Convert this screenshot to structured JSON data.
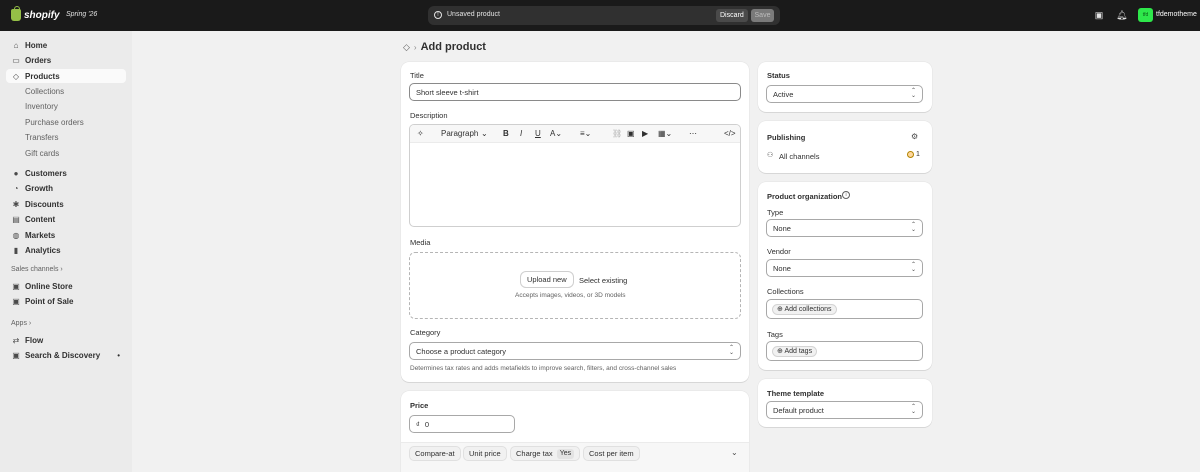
{
  "topbar": {
    "brand": "shopify",
    "edition": "Spring '26",
    "unsaved_label": "Unsaved product",
    "discard_label": "Discard",
    "save_label": "Save",
    "avatar_initials": "tfd",
    "store_name": "tfdemotheme"
  },
  "sidebar": {
    "main": [
      {
        "label": "Home",
        "icon": "home-icon"
      },
      {
        "label": "Orders",
        "icon": "inbox-icon"
      },
      {
        "label": "Products",
        "icon": "tag-icon"
      }
    ],
    "product_sub": [
      "Collections",
      "Inventory",
      "Purchase orders",
      "Transfers",
      "Gift cards"
    ],
    "more": [
      {
        "label": "Customers",
        "icon": "person-icon"
      },
      {
        "label": "Growth",
        "icon": "growth-icon"
      },
      {
        "label": "Discounts",
        "icon": "discount-icon"
      },
      {
        "label": "Content",
        "icon": "content-icon"
      },
      {
        "label": "Markets",
        "icon": "globe-icon"
      },
      {
        "label": "Analytics",
        "icon": "chart-icon"
      }
    ],
    "sales_channels_label": "Sales channels ›",
    "channels": [
      "Online Store",
      "Point of Sale"
    ],
    "apps_label": "Apps ›",
    "apps": [
      "Flow",
      "Search & Discovery"
    ]
  },
  "page": {
    "title": "Add product"
  },
  "product": {
    "title_label": "Title",
    "title_value": "Short sleeve t-shirt",
    "description_label": "Description",
    "paragraph_label": "Paragraph",
    "media_label": "Media",
    "upload_label": "Upload new",
    "select_existing_label": "Select existing",
    "media_hint": "Accepts images, videos, or 3D models",
    "category_label": "Category",
    "category_placeholder": "Choose a product category",
    "category_hint": "Determines tax rates and adds metafields to improve search, filters, and cross-channel sales"
  },
  "price": {
    "label": "Price",
    "currency_symbol": "₫",
    "value": "0",
    "chips": [
      "Compare-at",
      "Unit price",
      "Charge tax",
      "Cost per item"
    ],
    "charge_tax_value": "Yes"
  },
  "status": {
    "label": "Status",
    "value": "Active"
  },
  "publishing": {
    "label": "Publishing",
    "channels_label": "All channels",
    "count": "1"
  },
  "organization": {
    "label": "Product organization",
    "type_label": "Type",
    "type_value": "None",
    "vendor_label": "Vendor",
    "vendor_value": "None",
    "collections_label": "Collections",
    "add_collections": "Add collections",
    "tags_label": "Tags",
    "add_tags": "Add tags"
  },
  "theme": {
    "label": "Theme template",
    "value": "Default product"
  }
}
